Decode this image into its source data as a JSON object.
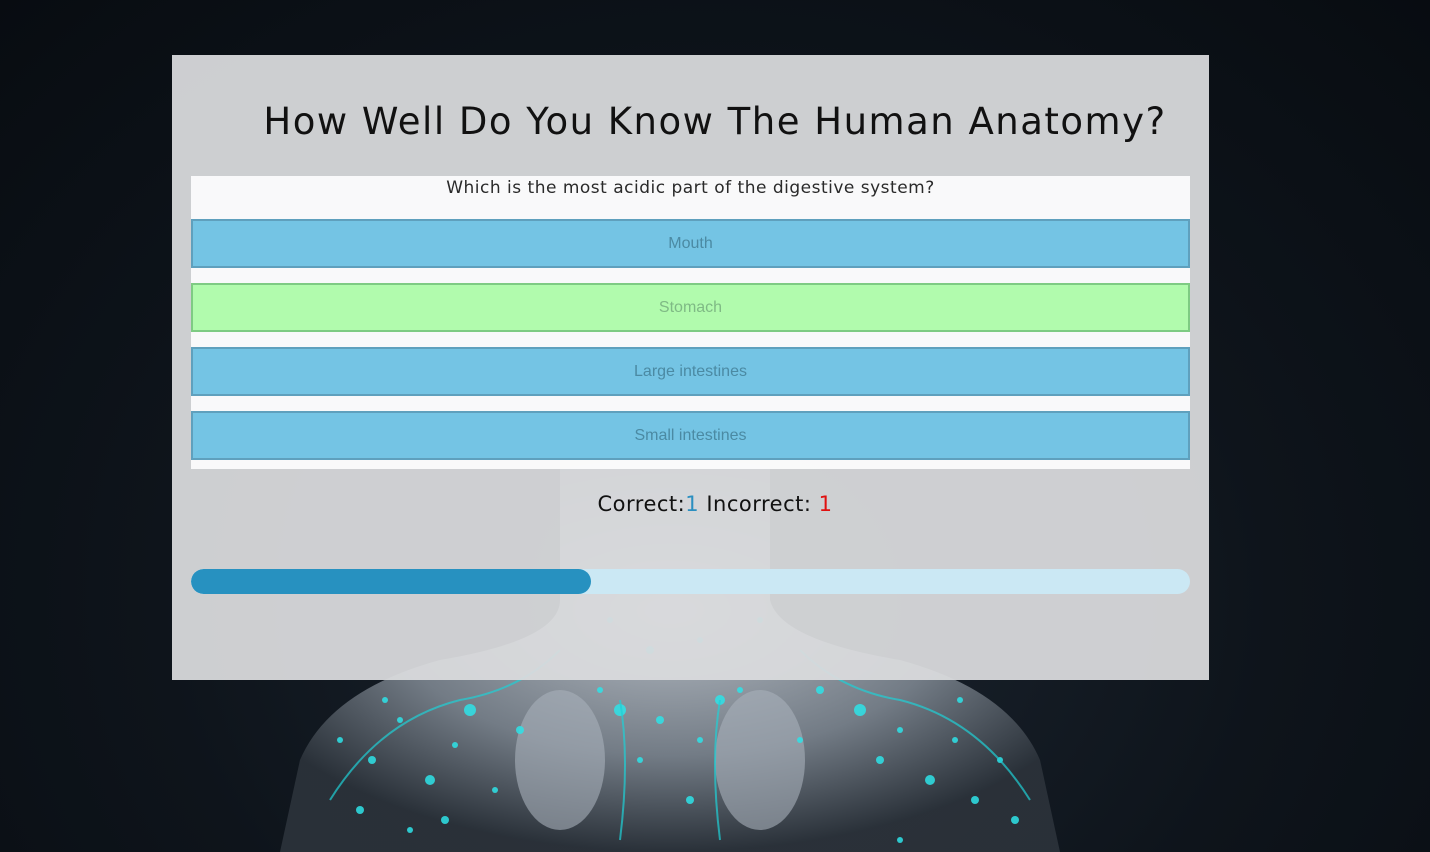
{
  "quiz": {
    "title": "How Well Do You Know The Human Anatomy?",
    "question": "Which is the most acidic part of the digestive system?",
    "answers": [
      {
        "label": "Mouth",
        "state": "default"
      },
      {
        "label": "Stomach",
        "state": "correct"
      },
      {
        "label": "Large intestines",
        "state": "default"
      },
      {
        "label": "Small intestines",
        "state": "default"
      }
    ],
    "score": {
      "correct_label": "Correct:",
      "correct_value": "1",
      "incorrect_label": "Incorrect:",
      "incorrect_value": "1"
    },
    "progress_fraction": 0.4
  },
  "colors": {
    "answer_default": "#74c4e4",
    "answer_correct": "#b1fbad",
    "progress_fill": "#2791c0",
    "progress_track": "#cbe8f4",
    "incorrect_text": "#e01010"
  }
}
